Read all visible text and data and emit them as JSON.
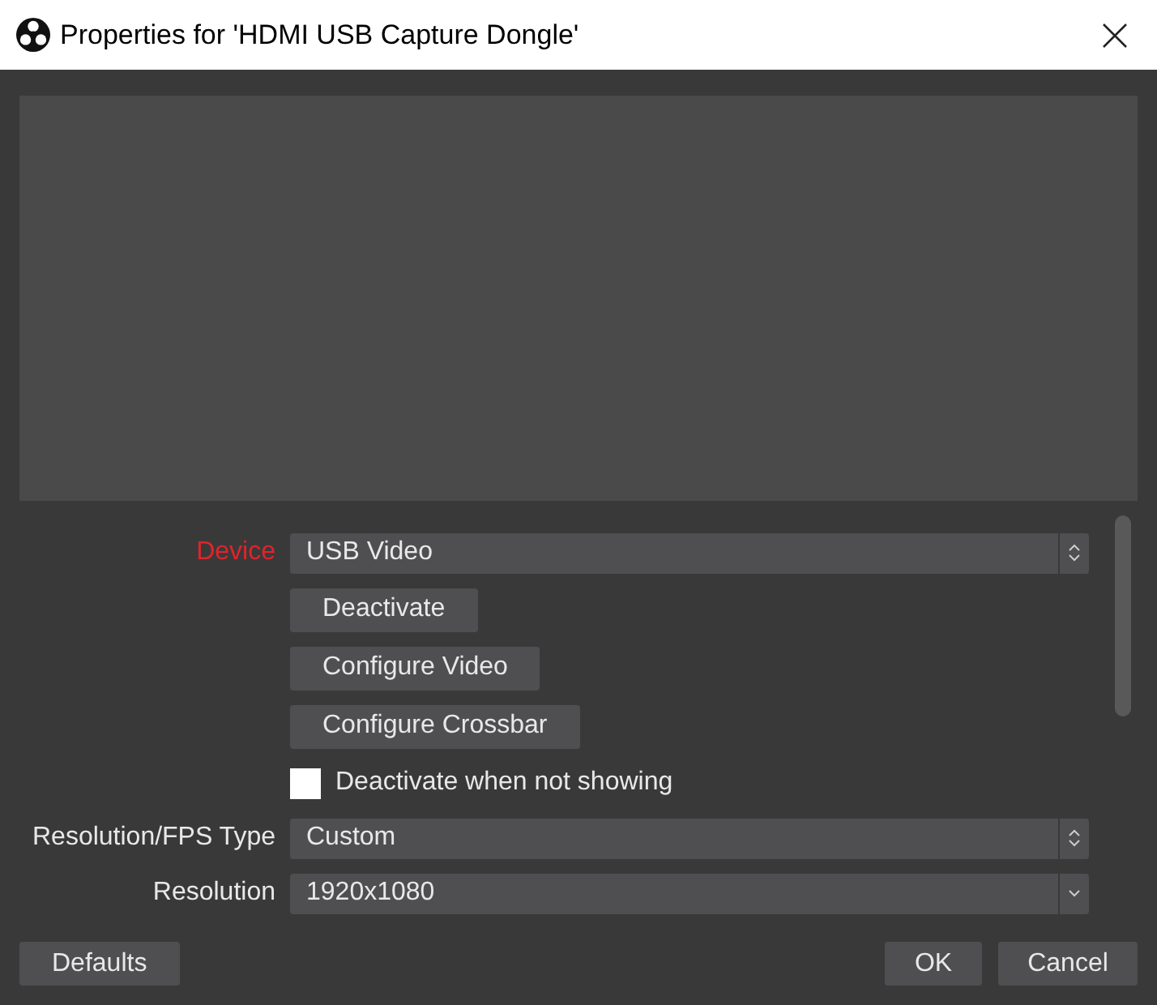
{
  "window": {
    "title": "Properties for 'HDMI USB Capture Dongle'"
  },
  "properties": [
    {
      "kind": "combo",
      "label": "Device",
      "error": true,
      "value": "USB Video"
    },
    {
      "kind": "button",
      "text": "Deactivate"
    },
    {
      "kind": "button",
      "text": "Configure Video"
    },
    {
      "kind": "button",
      "text": "Configure Crossbar"
    },
    {
      "kind": "checkbox",
      "text": "Deactivate when not showing",
      "checked": false
    },
    {
      "kind": "combo",
      "label": "Resolution/FPS Type",
      "error": false,
      "value": "Custom"
    },
    {
      "kind": "dropdown",
      "label": "Resolution",
      "error": false,
      "value": "1920x1080"
    }
  ],
  "buttons": {
    "left": [
      "Defaults"
    ],
    "right": [
      "OK",
      "Cancel"
    ]
  }
}
